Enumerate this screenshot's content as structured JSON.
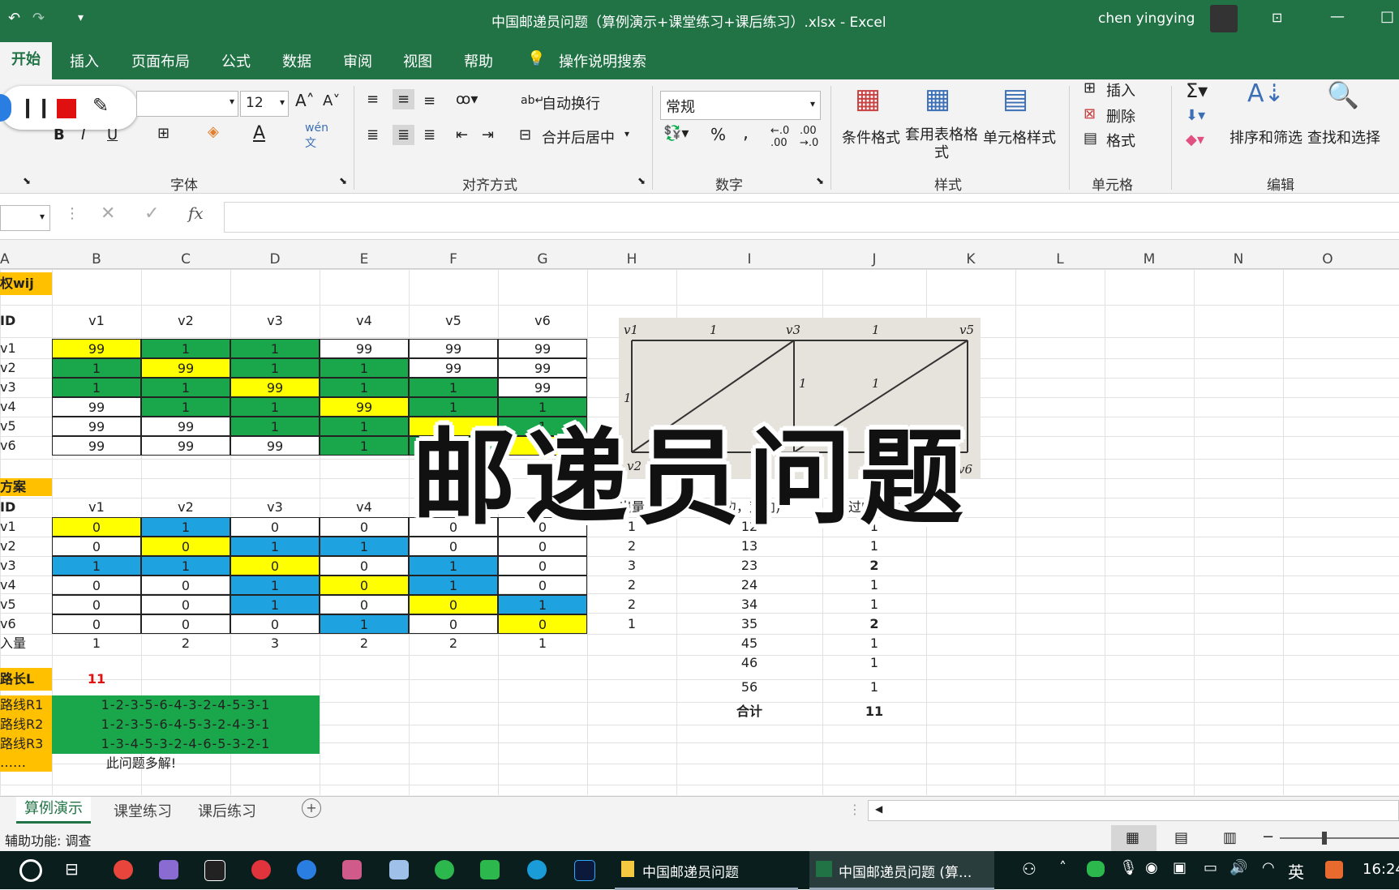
{
  "window": {
    "title": "中国邮递员问题（算例演示+课堂练习+课后练习）.xlsx  -  Excel",
    "user": "chen yingying"
  },
  "ribbon_tabs": [
    "开始",
    "插入",
    "页面布局",
    "公式",
    "数据",
    "审阅",
    "视图",
    "帮助",
    "操作说明搜索"
  ],
  "font_group": {
    "size": "12",
    "label": "字体"
  },
  "align_group": {
    "wrap": "自动换行",
    "merge": "合并后居中",
    "label": "对齐方式"
  },
  "number_group": {
    "format": "常规",
    "label": "数字"
  },
  "style_group": {
    "cond": "条件格式",
    "table": "套用表格格式",
    "cell": "单元格样式",
    "label": "样式"
  },
  "cells_group": {
    "insert": "插入",
    "delete": "删除",
    "format": "格式",
    "label": "单元格"
  },
  "edit_group": {
    "sort": "排序和筛选",
    "find": "查找和选择",
    "label": "编辑"
  },
  "formula_bar": {
    "fx": "fx"
  },
  "columns": [
    "A",
    "B",
    "C",
    "D",
    "E",
    "F",
    "G",
    "H",
    "I",
    "J",
    "K",
    "L",
    "M",
    "N",
    "O"
  ],
  "sheet": {
    "label_weight": "权wij",
    "label_id1": "ID",
    "v_headers": [
      "v1",
      "v2",
      "v3",
      "v4",
      "v5",
      "v6"
    ],
    "row_labels1": [
      "v1",
      "v2",
      "v3",
      "v4",
      "v5",
      "v6"
    ],
    "matrix1": [
      [
        "99",
        "1",
        "1",
        "99",
        "99",
        "99"
      ],
      [
        "1",
        "99",
        "1",
        "1",
        "99",
        "99"
      ],
      [
        "1",
        "1",
        "99",
        "1",
        "1",
        "99"
      ],
      [
        "99",
        "1",
        "1",
        "99",
        "1",
        "1"
      ],
      [
        "99",
        "99",
        "1",
        "1",
        "",
        "1"
      ],
      [
        "99",
        "99",
        "99",
        "1",
        "",
        ""
      ]
    ],
    "label_plan": "方案",
    "label_id2": "ID",
    "row_labels2": [
      "v1",
      "v2",
      "v3",
      "v4",
      "v5",
      "v6",
      "入量"
    ],
    "matrix2": [
      [
        "0",
        "1",
        "0",
        "0",
        "0",
        "0"
      ],
      [
        "0",
        "0",
        "1",
        "1",
        "0",
        "0"
      ],
      [
        "1",
        "1",
        "0",
        "0",
        "1",
        "0"
      ],
      [
        "0",
        "0",
        "1",
        "0",
        "1",
        "0"
      ],
      [
        "0",
        "0",
        "1",
        "0",
        "0",
        "1"
      ],
      [
        "0",
        "0",
        "0",
        "1",
        "0",
        "0"
      ],
      [
        "1",
        "2",
        "3",
        "2",
        "2",
        "1"
      ]
    ],
    "out_header": "出量",
    "out_values": [
      "1",
      "2",
      "3",
      "2",
      "2",
      "1"
    ],
    "edge_header": "(边，双向)",
    "edges": [
      "12",
      "13",
      "23",
      "24",
      "34",
      "35",
      "45",
      "46",
      "56"
    ],
    "pass_header": "过的次数",
    "passes": [
      "1",
      "1",
      "2",
      "1",
      "1",
      "2",
      "1",
      "1",
      "1"
    ],
    "total_label": "合计",
    "total_value": "11",
    "path_len_label": "路长L",
    "path_len_value": "11",
    "routes": [
      {
        "label": "路线R1",
        "value": "1-2-3-5-6-4-3-2-4-5-3-1"
      },
      {
        "label": "路线R2",
        "value": "1-2-3-5-6-4-5-3-2-4-3-1"
      },
      {
        "label": "路线R3",
        "value": "1-3-4-5-3-2-4-6-5-3-2-1"
      }
    ],
    "route_more": "……",
    "multi_note": "此问题多解!"
  },
  "graph_image": {
    "nodes": [
      "v1",
      "v3",
      "v5",
      "v2",
      "v6"
    ],
    "edge_labels": [
      "1",
      "1",
      "1",
      "1",
      "1"
    ]
  },
  "overlay_title": "邮递员问题",
  "sheet_tabs": [
    "算例演示",
    "课堂练习",
    "课后练习"
  ],
  "status": "辅助功能: 调查",
  "taskbar": {
    "item1": "中国邮递员问题",
    "item2": "中国邮递员问题 (算...",
    "ime": "英",
    "time": "16:24"
  },
  "colors": {
    "excel_green": "#217346",
    "cell_yellow": "#ffff00",
    "cell_green": "#1aa64a",
    "cell_blue": "#1fa3e0",
    "header_orange": "#ffc000"
  }
}
